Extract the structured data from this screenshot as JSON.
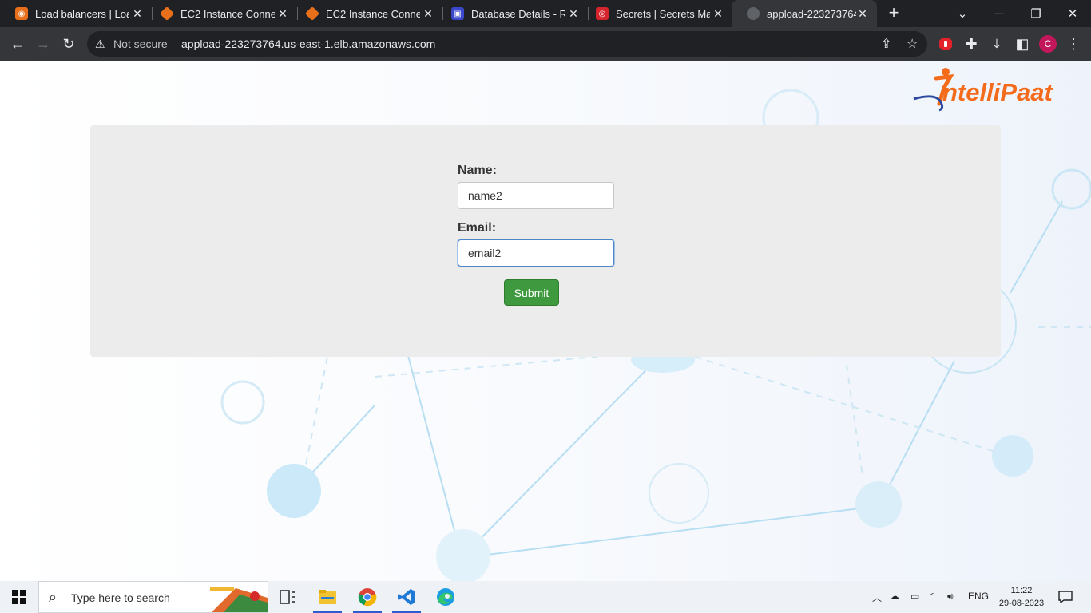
{
  "browser": {
    "tabs": [
      {
        "title": "Load balancers | Load",
        "favicon": "aws-elb-icon",
        "color": "#e8701a"
      },
      {
        "title": "EC2 Instance Connect",
        "favicon": "aws-ec2-icon",
        "color": "#e8701a"
      },
      {
        "title": "EC2 Instance Connect",
        "favicon": "aws-ec2-icon",
        "color": "#e8701a"
      },
      {
        "title": "Database Details - RDS",
        "favicon": "aws-rds-icon",
        "color": "#3b48cc"
      },
      {
        "title": "Secrets | Secrets Mana",
        "favicon": "aws-secrets-icon",
        "color": "#d6242d"
      },
      {
        "title": "appload-223273764.us",
        "favicon": "globe-icon",
        "color": "#5f6368"
      }
    ],
    "address_bar": {
      "security_label": "Not secure",
      "url": "appload-223273764.us-east-1.elb.amazonaws.com"
    },
    "profile_initial": "C"
  },
  "page": {
    "logo_text": "ntelliPaat",
    "form": {
      "name_label": "Name:",
      "name_value": "name2",
      "email_label": "Email:",
      "email_value": "email2",
      "submit_label": "Submit"
    }
  },
  "taskbar": {
    "search_placeholder": "Type here to search",
    "language": "ENG",
    "time": "11:22",
    "date": "29-08-2023"
  },
  "colors": {
    "submit_button": "#3f9a3f",
    "logo_orange": "#f46b1c",
    "card_background": "#ececec"
  }
}
